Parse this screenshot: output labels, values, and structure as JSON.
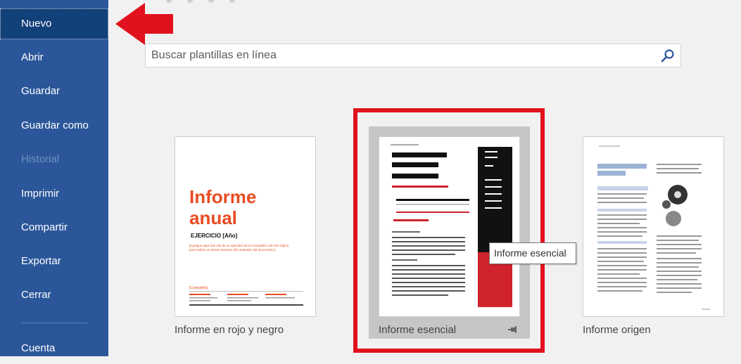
{
  "sidebar": {
    "items": [
      {
        "label": "Nuevo"
      },
      {
        "label": "Abrir"
      },
      {
        "label": "Guardar"
      },
      {
        "label": "Guardar como"
      },
      {
        "label": "Historial"
      },
      {
        "label": "Imprimir"
      },
      {
        "label": "Compartir"
      },
      {
        "label": "Exportar"
      },
      {
        "label": "Cerrar"
      },
      {
        "label": "Cuenta"
      }
    ]
  },
  "search": {
    "placeholder": "Buscar plantillas en línea",
    "icon": "search-icon"
  },
  "templates": [
    {
      "label": "Informe en rojo y negro",
      "thumb": {
        "title_line1": "Informe",
        "title_line2": "anual",
        "subtitle": "EJERCICIO [Año]",
        "body": "[Agregue aquí una cita de un ejecutivo de la compañía o de otro tópico para indicar un breve resumen del contenido del documento.]",
        "company": "[Compañía]"
      }
    },
    {
      "label": "Informe esencial",
      "pin_icon": "pin-icon"
    },
    {
      "label": "Informe origen"
    }
  ],
  "tooltip": {
    "text": "Informe esencial"
  },
  "colors": {
    "sidebar": "#2b579a",
    "sidebar_active": "#124078",
    "highlight": "#e1121e",
    "accent_orange": "#e84c22",
    "essential_red": "#d0232b"
  }
}
